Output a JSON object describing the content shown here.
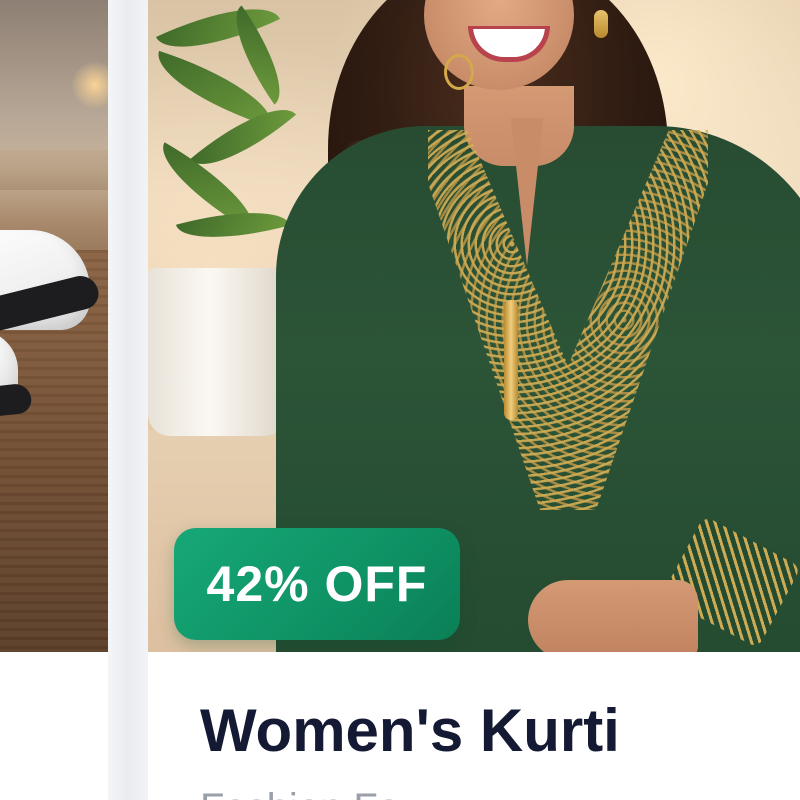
{
  "products": {
    "left_card": {
      "image": "sneakers-photo"
    },
    "main_card": {
      "image": "green-embroidered-kurti-photo",
      "discount_badge": "42% OFF",
      "title": "Women's Kurti",
      "category": "Fashion Fa"
    }
  },
  "colors": {
    "badge_green": "#0f9466",
    "title_text": "#141a33",
    "category_text": "#9aa0a8",
    "card_background": "#ffffff",
    "page_background": "#eceef2"
  }
}
